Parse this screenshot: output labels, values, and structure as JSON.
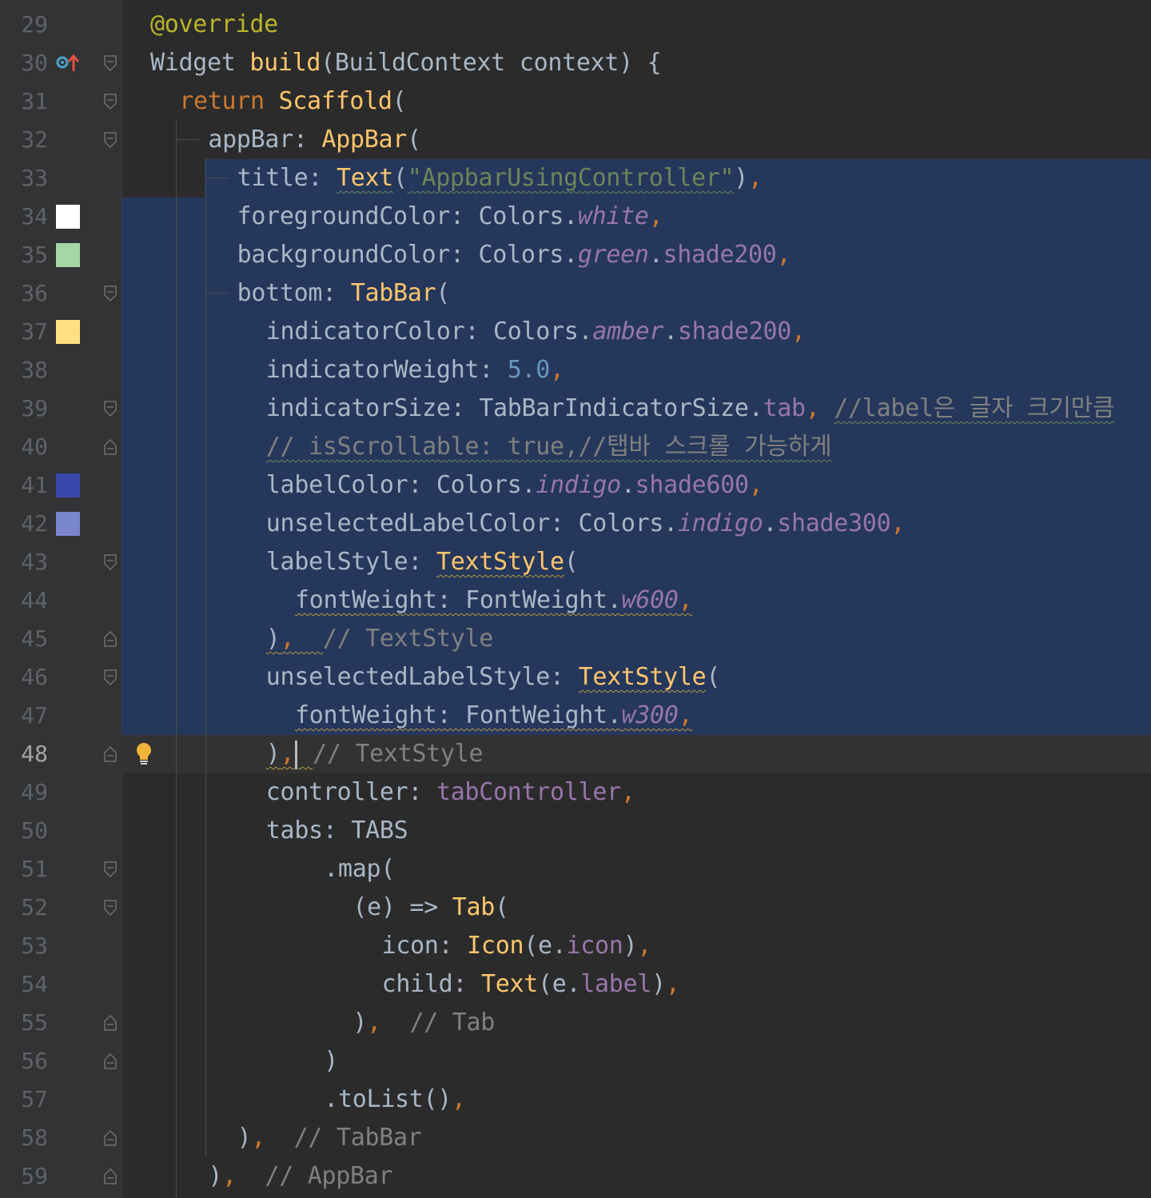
{
  "editor": {
    "language": "Dart",
    "caret_line": 48,
    "lines": [
      {
        "num": "29",
        "tokens": [
          [
            "anno",
            "@override"
          ]
        ]
      },
      {
        "num": "30",
        "tokens": [
          [
            "txt",
            "Widget "
          ],
          [
            "fn",
            "build"
          ],
          [
            "txt",
            "(BuildContext context) {"
          ]
        ]
      },
      {
        "num": "31",
        "tokens": [
          [
            "kw",
            "return "
          ],
          [
            "cl",
            "Scaffold"
          ],
          [
            "txt",
            "("
          ]
        ]
      },
      {
        "num": "32",
        "tokens": [
          [
            "txt",
            "appBar: "
          ],
          [
            "cl",
            "AppBar"
          ],
          [
            "txt",
            "("
          ]
        ]
      },
      {
        "num": "33",
        "tokens": [
          [
            "txt",
            "title: "
          ],
          [
            "cl",
            "Text"
          ],
          [
            "txt",
            "("
          ],
          [
            "str",
            "\"AppbarUsingController\""
          ],
          [
            "txt",
            ")"
          ],
          [
            "kw",
            ","
          ]
        ]
      },
      {
        "num": "34",
        "tokens": [
          [
            "txt",
            "foregroundColor: Colors."
          ],
          [
            "it",
            "white"
          ],
          [
            "kw",
            ","
          ]
        ]
      },
      {
        "num": "35",
        "tokens": [
          [
            "txt",
            "backgroundColor: Colors."
          ],
          [
            "it",
            "green"
          ],
          [
            "txt",
            "."
          ],
          [
            "prop",
            "shade200"
          ],
          [
            "kw",
            ","
          ]
        ]
      },
      {
        "num": "36",
        "tokens": [
          [
            "txt",
            "bottom: "
          ],
          [
            "cl",
            "TabBar"
          ],
          [
            "txt",
            "("
          ]
        ]
      },
      {
        "num": "37",
        "tokens": [
          [
            "txt",
            "indicatorColor: Colors."
          ],
          [
            "it",
            "amber"
          ],
          [
            "txt",
            "."
          ],
          [
            "prop",
            "shade200"
          ],
          [
            "kw",
            ","
          ]
        ]
      },
      {
        "num": "38",
        "tokens": [
          [
            "txt",
            "indicatorWeight: "
          ],
          [
            "num",
            "5.0"
          ],
          [
            "kw",
            ","
          ]
        ]
      },
      {
        "num": "39",
        "tokens": [
          [
            "txt",
            "indicatorSize: TabBarIndicatorSize."
          ],
          [
            "prop",
            "tab"
          ],
          [
            "kw",
            ", "
          ],
          [
            "cm",
            "//label은 글자 크기만큼"
          ]
        ]
      },
      {
        "num": "40",
        "tokens": [
          [
            "cm",
            "// isScrollable: true,//탭바 스크롤 가능하게"
          ]
        ]
      },
      {
        "num": "41",
        "tokens": [
          [
            "txt",
            "labelColor: Colors."
          ],
          [
            "it",
            "indigo"
          ],
          [
            "txt",
            "."
          ],
          [
            "prop",
            "shade600"
          ],
          [
            "kw",
            ","
          ]
        ]
      },
      {
        "num": "42",
        "tokens": [
          [
            "txt",
            "unselectedLabelColor: Colors."
          ],
          [
            "it",
            "indigo"
          ],
          [
            "txt",
            "."
          ],
          [
            "prop",
            "shade300"
          ],
          [
            "kw",
            ","
          ]
        ]
      },
      {
        "num": "43",
        "tokens": [
          [
            "txt",
            "labelStyle: "
          ],
          [
            "cl",
            "TextStyle"
          ],
          [
            "txt",
            "("
          ]
        ]
      },
      {
        "num": "44",
        "tokens": [
          [
            "txt",
            "fontWeight: FontWeight."
          ],
          [
            "it",
            "w600"
          ],
          [
            "kw",
            ","
          ]
        ]
      },
      {
        "num": "45",
        "tokens": [
          [
            "txt",
            ")"
          ],
          [
            "kw",
            ",  "
          ],
          [
            "cm",
            "// TextStyle"
          ]
        ]
      },
      {
        "num": "46",
        "tokens": [
          [
            "txt",
            "unselectedLabelStyle: "
          ],
          [
            "cl",
            "TextStyle"
          ],
          [
            "txt",
            "("
          ]
        ]
      },
      {
        "num": "47",
        "tokens": [
          [
            "txt",
            "fontWeight: FontWeight."
          ],
          [
            "it",
            "w300"
          ],
          [
            "kw",
            ","
          ]
        ]
      },
      {
        "num": "48",
        "tokens": [
          [
            "txt",
            ")"
          ],
          [
            "kw",
            ","
          ],
          [
            "cursor",
            ""
          ],
          [
            "kw",
            " "
          ],
          [
            "cm",
            "// TextStyle"
          ]
        ]
      },
      {
        "num": "49",
        "tokens": [
          [
            "txt",
            "controller: "
          ],
          [
            "prop",
            "tabController"
          ],
          [
            "kw",
            ","
          ]
        ]
      },
      {
        "num": "50",
        "tokens": [
          [
            "txt",
            "tabs: TABS"
          ]
        ]
      },
      {
        "num": "51",
        "tokens": [
          [
            "txt",
            ".map("
          ]
        ]
      },
      {
        "num": "52",
        "tokens": [
          [
            "txt",
            "(e) => "
          ],
          [
            "cl",
            "Tab"
          ],
          [
            "txt",
            "("
          ]
        ]
      },
      {
        "num": "53",
        "tokens": [
          [
            "txt",
            "icon: "
          ],
          [
            "cl",
            "Icon"
          ],
          [
            "txt",
            "(e."
          ],
          [
            "prop",
            "icon"
          ],
          [
            "txt",
            ")"
          ],
          [
            "kw",
            ","
          ]
        ]
      },
      {
        "num": "54",
        "tokens": [
          [
            "txt",
            "child: "
          ],
          [
            "cl",
            "Text"
          ],
          [
            "txt",
            "(e."
          ],
          [
            "prop",
            "label"
          ],
          [
            "txt",
            ")"
          ],
          [
            "kw",
            ","
          ]
        ]
      },
      {
        "num": "55",
        "tokens": [
          [
            "txt",
            ")"
          ],
          [
            "kw",
            ",  "
          ],
          [
            "cm",
            "// Tab"
          ]
        ]
      },
      {
        "num": "56",
        "tokens": [
          [
            "txt",
            ")"
          ]
        ]
      },
      {
        "num": "57",
        "tokens": [
          [
            "txt",
            ".toList()"
          ],
          [
            "kw",
            ","
          ]
        ]
      },
      {
        "num": "58",
        "tokens": [
          [
            "txt",
            ")"
          ],
          [
            "kw",
            ",  "
          ],
          [
            "cm",
            "// TabBar"
          ]
        ]
      },
      {
        "num": "59",
        "tokens": [
          [
            "txt",
            ")"
          ],
          [
            "kw",
            ",  "
          ],
          [
            "cm",
            "// AppBar"
          ]
        ]
      }
    ]
  },
  "colors": {
    "swatch_white": "#ffffff",
    "swatch_green_shade200": "#a5d6a7",
    "swatch_amber_shade200": "#ffe082",
    "swatch_indigo_shade600": "#3949ab",
    "swatch_indigo_shade300": "#7986cb"
  },
  "icons": {
    "override": "override-up-arrow-icon",
    "bulb": "lightbulb-icon",
    "fold": "fold-marker-icon"
  }
}
